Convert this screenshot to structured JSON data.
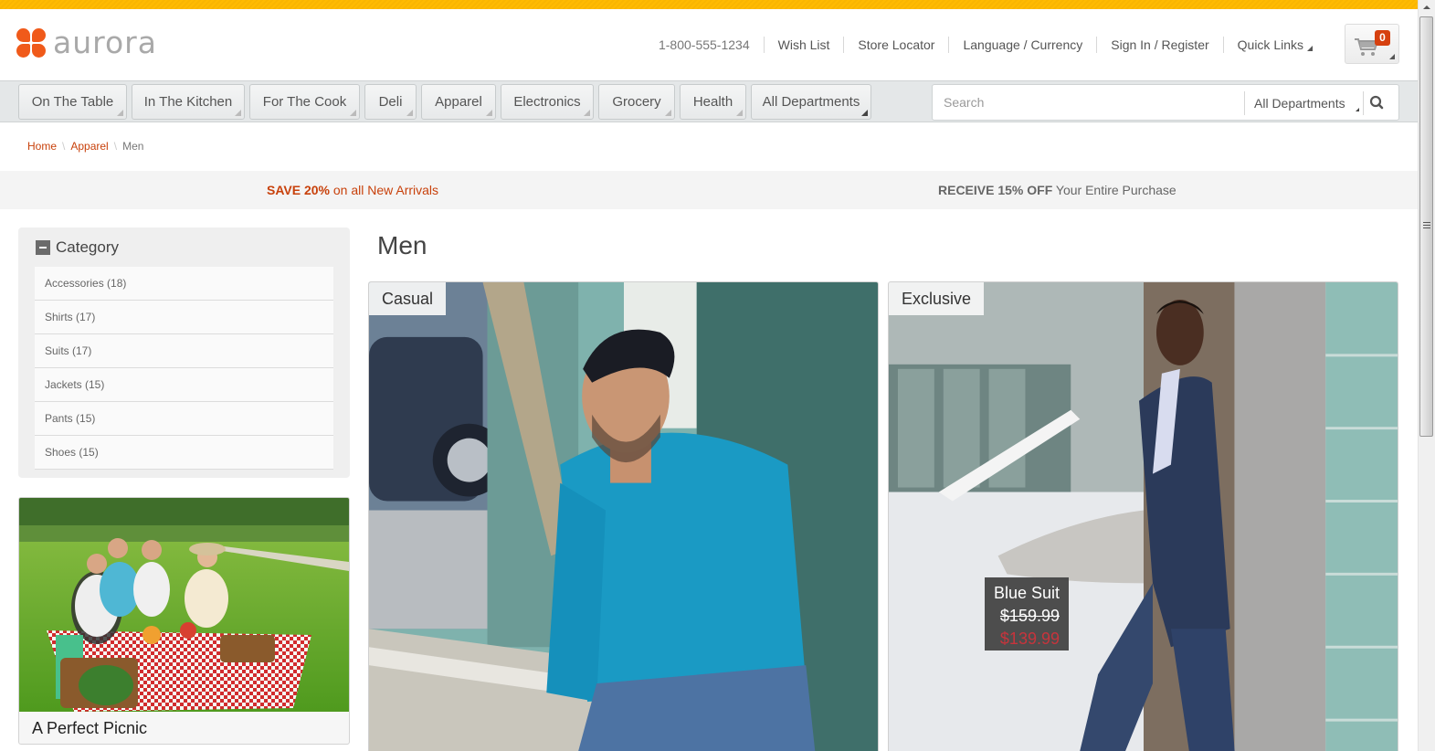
{
  "brand": {
    "name": "aurora",
    "accent": "#f05a1a",
    "topbar_color": "#ffbb00"
  },
  "header": {
    "phone": "1-800-555-1234",
    "links": [
      "Wish List",
      "Store Locator",
      "Language / Currency",
      "Sign In / Register",
      "Quick Links"
    ],
    "cart": {
      "icon": "cart-icon",
      "count": "0"
    }
  },
  "nav": {
    "tabs": [
      "On The Table",
      "In The Kitchen",
      "For The Cook",
      "Deli",
      "Apparel",
      "Electronics",
      "Grocery",
      "Health",
      "All Departments"
    ],
    "search": {
      "placeholder": "Search",
      "value": "",
      "department": "All Departments",
      "icon": "search-icon"
    }
  },
  "breadcrumb": {
    "items": [
      "Home",
      "Apparel"
    ],
    "current": "Men"
  },
  "promos": {
    "left": {
      "bold": "SAVE 20%",
      "text": " on all New Arrivals"
    },
    "right": {
      "bold": "RECEIVE 15% OFF",
      "text": " Your Entire Purchase"
    }
  },
  "sidebar": {
    "category": {
      "title": "Category",
      "items": [
        "Accessories (18)",
        "Shirts (17)",
        "Suits (17)",
        "Jackets (15)",
        "Pants (15)",
        "Shoes (15)"
      ]
    },
    "feature": {
      "caption": "A Perfect Picnic"
    }
  },
  "main": {
    "title": "Men",
    "cards": [
      {
        "tag": "Casual"
      },
      {
        "tag": "Exclusive",
        "product": {
          "name": "Blue Suit",
          "old_price": "$159.99",
          "new_price": "$139.99"
        }
      }
    ]
  }
}
